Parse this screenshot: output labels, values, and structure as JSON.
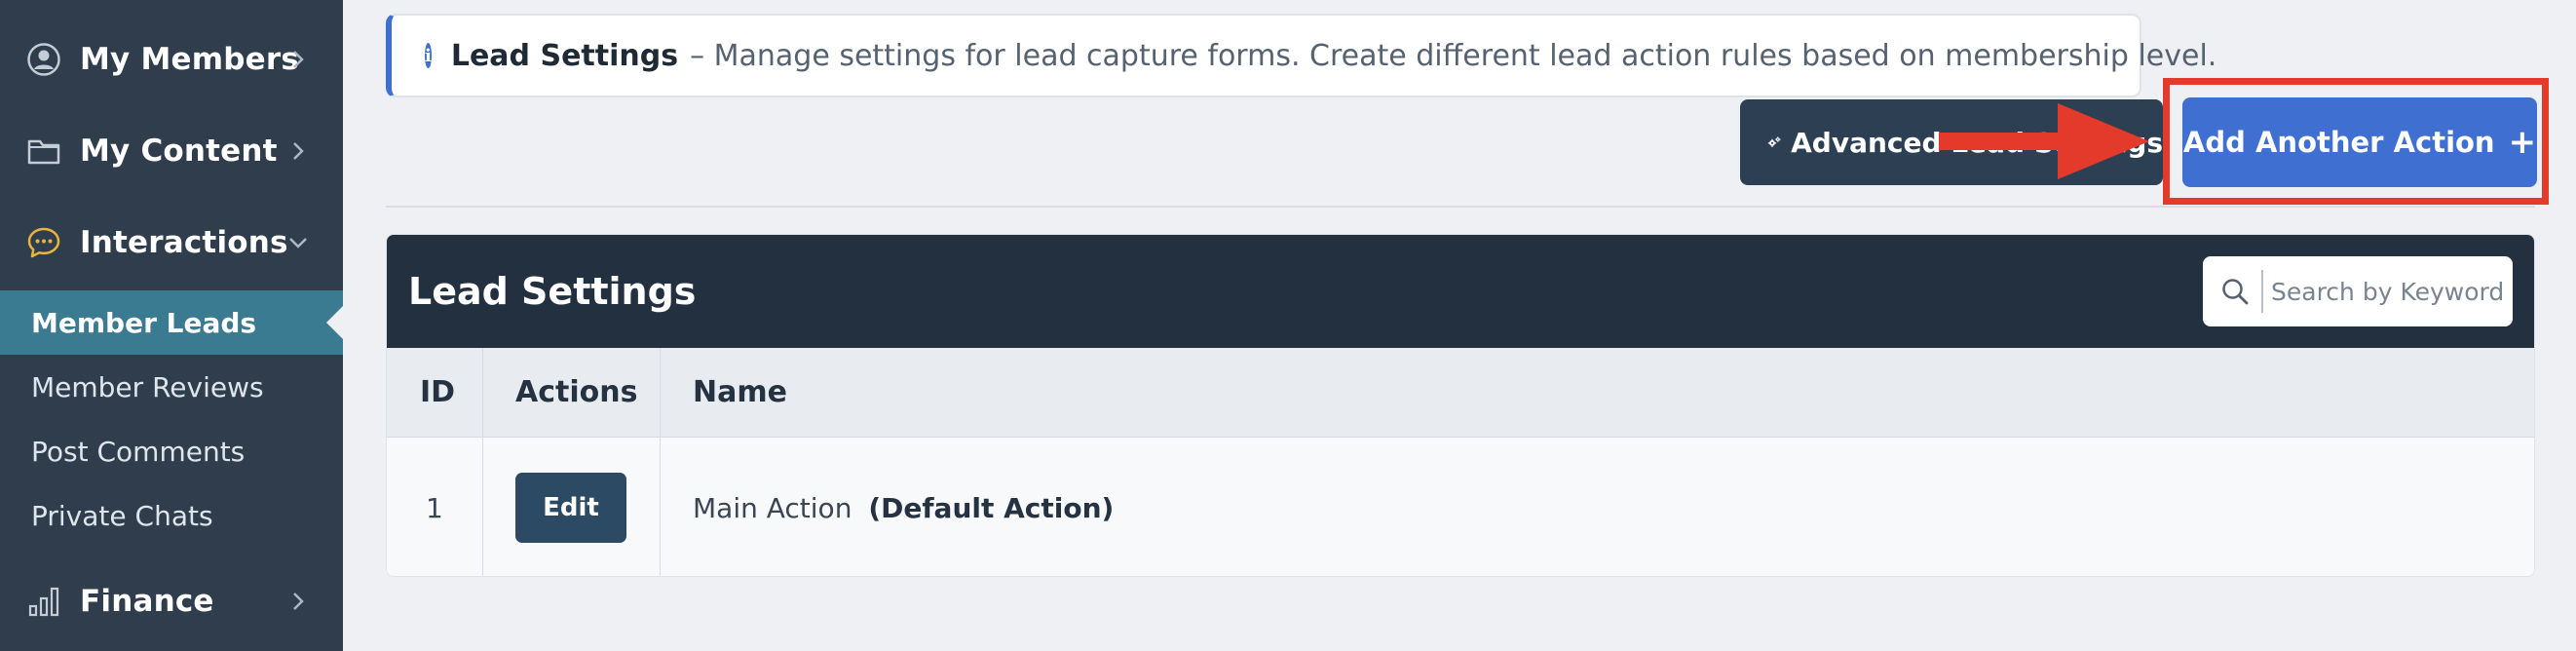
{
  "sidebar": {
    "main_items": [
      {
        "label": "My Members",
        "icon": "user-circle-icon"
      },
      {
        "label": "My Content",
        "icon": "folder-icon"
      },
      {
        "label": "Interactions",
        "icon": "chat-bubble-icon"
      },
      {
        "label": "Finance",
        "icon": "bar-chart-icon"
      }
    ],
    "sub_items": [
      "Member Leads",
      "Member Reviews",
      "Post Comments",
      "Private Chats"
    ],
    "active_sub": "Member Leads"
  },
  "banner": {
    "title": "Lead Settings",
    "description": "– Manage settings for lead capture forms. Create different lead action rules based on membership level."
  },
  "toolbar": {
    "advanced_label": "Advanced Lead Settings",
    "add_label": "Add Another Action"
  },
  "panel": {
    "title": "Lead Settings",
    "search_placeholder": "Search by Keyword",
    "columns": [
      "ID",
      "Actions",
      "Name"
    ],
    "rows": [
      {
        "id": "1",
        "action_label": "Edit",
        "name": "Main Action",
        "name_suffix": "(Default Action)"
      }
    ]
  },
  "colors": {
    "sidebar_bg": "#2f3d4c",
    "active_item": "#3a7b91",
    "primary_button": "#3f6fd1",
    "dark_button": "#2d3f53",
    "highlight_red": "#e43a2c"
  }
}
